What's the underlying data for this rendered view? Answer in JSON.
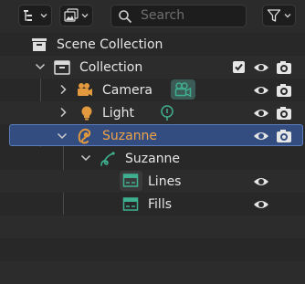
{
  "header": {
    "search_placeholder": "Search",
    "display_mode_icon": "outliner-display-mode-icon",
    "filter_icon": "funnel-icon"
  },
  "tree": {
    "scene_collection": "Scene Collection",
    "collection": "Collection",
    "camera": "Camera",
    "light": "Light",
    "suzanne_object": "Suzanne",
    "suzanne_data": "Suzanne",
    "lines": "Lines",
    "fills": "Fills"
  },
  "colors": {
    "selection": "#334d80",
    "object_orange": "#e39a3e",
    "data_green": "#3fb08f"
  }
}
